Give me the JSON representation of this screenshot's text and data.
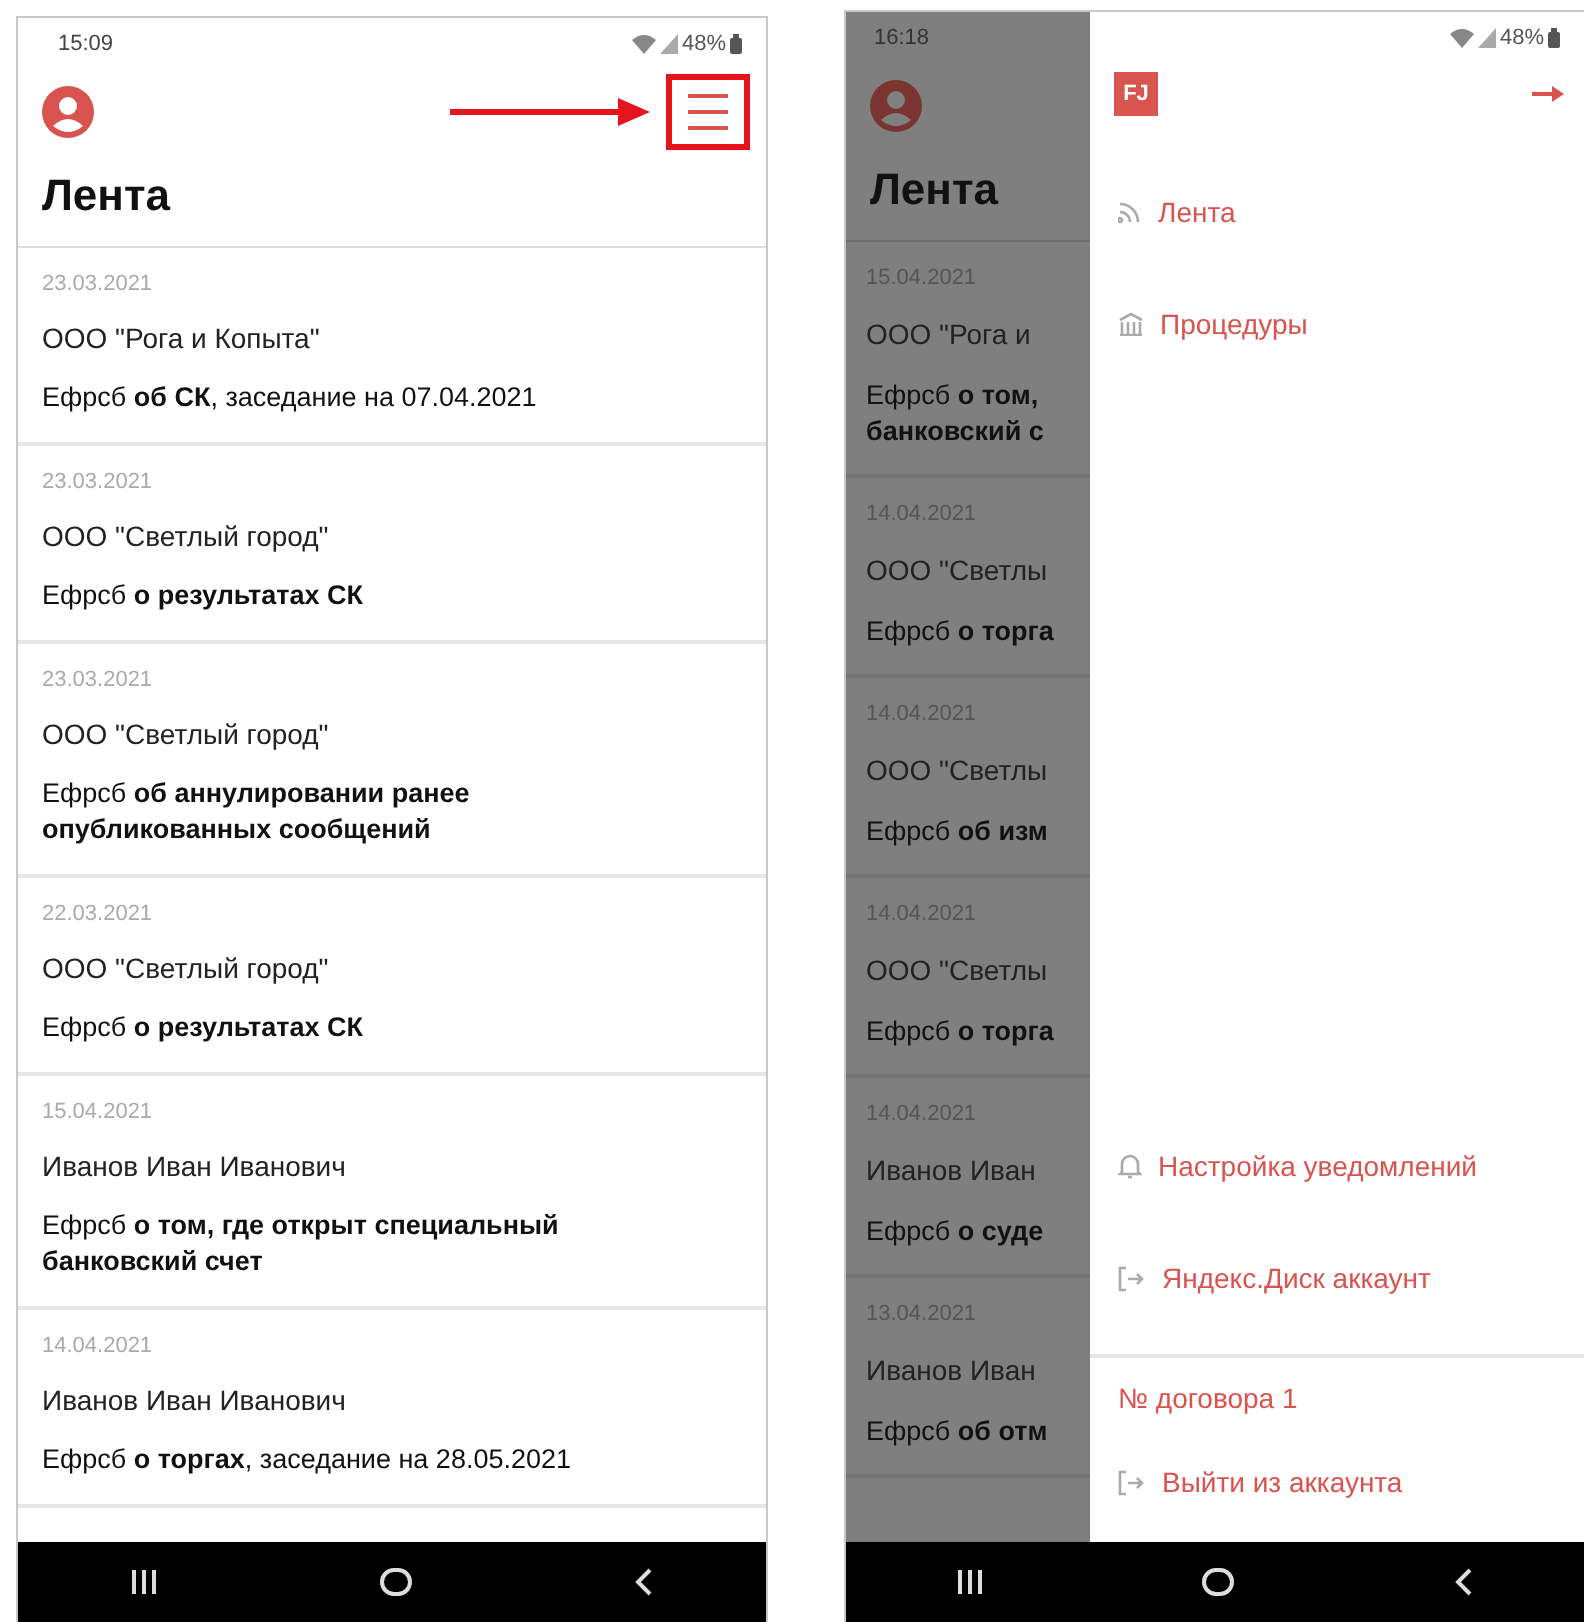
{
  "left_screen": {
    "status_bar": {
      "time": "15:09",
      "battery": "48%"
    },
    "menu_button": {
      "highlighted": true
    },
    "title": "Лента",
    "feed": [
      {
        "date": "23.03.2021",
        "party": "ООО \"Рога и Копыта\"",
        "desc": "Ефрсб **об СК**, заседание на 07.04.2021"
      },
      {
        "date": "23.03.2021",
        "party": "ООО \"Светлый город\"",
        "desc": "Ефрсб **о результатах СК**"
      },
      {
        "date": "23.03.2021",
        "party": "ООО \"Светлый город\"",
        "desc": "Ефрсб **об аннулировании ранее опубликованных сообщений**"
      },
      {
        "date": "22.03.2021",
        "party": "ООО \"Светлый город\"",
        "desc": "Ефрсб **о результатах СК**"
      },
      {
        "date": "15.04.2021",
        "party": "Иванов Иван Иванович",
        "desc": "Ефрсб **о том, где открыт специальный банковский счет**"
      },
      {
        "date": "14.04.2021",
        "party": "Иванов Иван Иванович",
        "desc": "Ефрсб **о торгах**, заседание на 28.05.2021"
      }
    ]
  },
  "right_screen": {
    "status_bar": {
      "time": "16:18",
      "battery": "48%"
    },
    "title": "Лента",
    "feed": [
      {
        "date": "15.04.2021",
        "party": "ООО \"Рога и",
        "desc_lines": [
          "Ефрсб **о том,**",
          "**банковский с**"
        ]
      },
      {
        "date": "14.04.2021",
        "party": "ООО \"Светлы",
        "desc_lines": [
          "Ефрсб **о торга**"
        ]
      },
      {
        "date": "14.04.2021",
        "party": "ООО \"Светлы",
        "desc_lines": [
          "Ефрсб **об изм**"
        ]
      },
      {
        "date": "14.04.2021",
        "party": "ООО \"Светлы",
        "desc_lines": [
          "Ефрсб **о торга**"
        ]
      },
      {
        "date": "14.04.2021",
        "party": "Иванов Иван",
        "desc_lines": [
          "Ефрсб **о суде**"
        ]
      },
      {
        "date": "13.04.2021",
        "party": "Иванов Иван",
        "desc_lines": [
          "Ефрсб **об отм**"
        ]
      }
    ],
    "drawer": {
      "logo": "FJ",
      "top_items": [
        {
          "kind": "feed",
          "label": "Лента"
        },
        {
          "kind": "procedures",
          "label": "Процедуры"
        }
      ],
      "bottom_items": [
        {
          "kind": "notifications",
          "label": "Настройка уведомлений"
        },
        {
          "kind": "login",
          "label": "Яндекс.Диск аккаунт"
        }
      ],
      "contract": "№ договора 1",
      "logout": {
        "kind": "login",
        "label": "Выйти из аккаунта"
      }
    }
  }
}
